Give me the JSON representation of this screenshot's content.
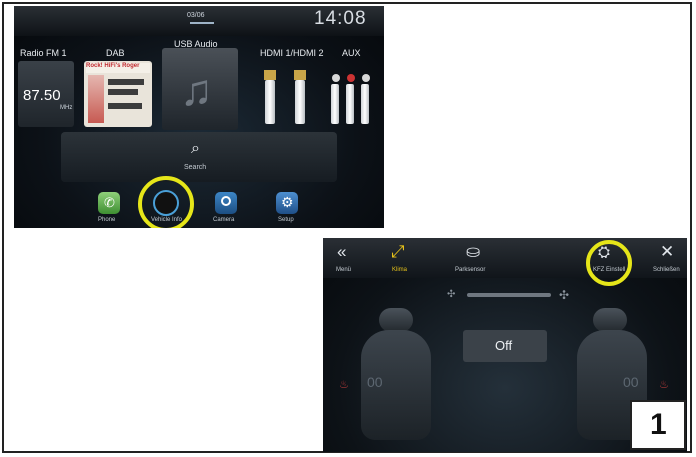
{
  "screen1": {
    "page_indicator": "03/06",
    "clock": "14:08",
    "sources": {
      "radio": {
        "label": "Radio FM 1",
        "frequency": "87.50",
        "unit": "MHz"
      },
      "dab": {
        "label": "DAB",
        "art_title": "Rock! HiFi's Roger"
      },
      "usb": {
        "label": "USB Audio"
      },
      "hdmi": {
        "label": "HDMI 1/HDMI 2"
      },
      "aux": {
        "label": "AUX"
      }
    },
    "search": {
      "label": "Search",
      "icon": "search-icon"
    },
    "dock": [
      {
        "label": "Phone",
        "icon": "phone-icon"
      },
      {
        "label": "Vehicle Info",
        "icon": "vehicle-info-icon"
      },
      {
        "label": "Camera",
        "icon": "camera-icon"
      },
      {
        "label": "Setup",
        "icon": "gear-icon"
      }
    ]
  },
  "screen2": {
    "nav": [
      {
        "label": "Menü",
        "icon": "back-chevron-icon"
      },
      {
        "label": "Klima",
        "icon": "climate-icon"
      },
      {
        "label": "Parksensor",
        "icon": "park-sensor-icon"
      },
      {
        "label": "KFZ Einstell",
        "icon": "car-settings-icon"
      },
      {
        "label": "Schließen",
        "icon": "close-icon"
      }
    ],
    "status": "Off",
    "left_value": "00",
    "right_value": "00"
  },
  "step_number": "1",
  "colors": {
    "highlight": "#e6e619",
    "screen_bg": "#0c1117"
  }
}
